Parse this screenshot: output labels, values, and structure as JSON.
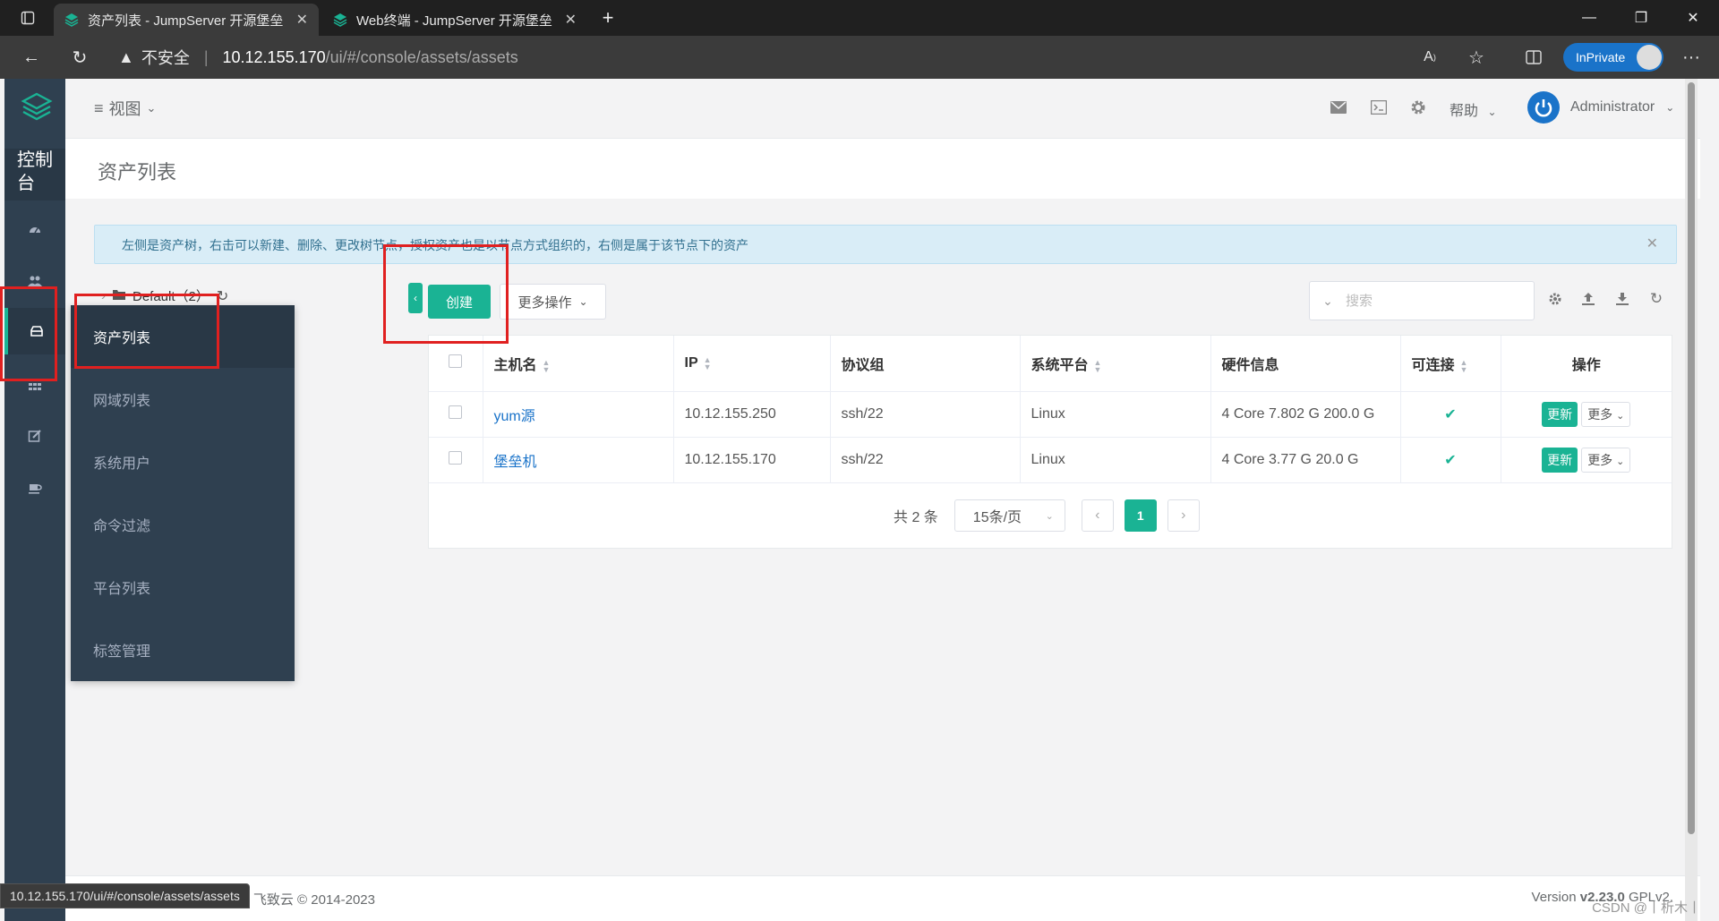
{
  "browser": {
    "tabs": [
      {
        "title": "资产列表 - JumpServer 开源堡垒",
        "active": true
      },
      {
        "title": "Web终端 - JumpServer 开源堡垒",
        "active": false
      }
    ],
    "security_label": "不安全",
    "url_host": "10.12.155.170",
    "url_path": "/ui/#/console/assets/assets",
    "inprivate_label": "InPrivate",
    "status_url": "10.12.155.170/ui/#/console/assets/assets"
  },
  "sidebar": {
    "console_label": "控制台",
    "icons": [
      "dashboard-icon",
      "users-icon",
      "assets-icon",
      "applications-icon",
      "edit-icon",
      "coffee-icon"
    ]
  },
  "header": {
    "view_label": "视图",
    "help_label": "帮助",
    "user_name": "Administrator"
  },
  "page": {
    "title": "资产列表",
    "alert": "左侧是资产树，右击可以新建、删除、更改树节点，授权资产也是以节点方式组织的，右侧是属于该节点下的资产",
    "tree_root": "Default（2）"
  },
  "submenu": {
    "items": [
      "资产列表",
      "网域列表",
      "系统用户",
      "命令过滤",
      "平台列表",
      "标签管理"
    ]
  },
  "toolbar": {
    "create_label": "创建",
    "more_actions_label": "更多操作",
    "search_placeholder": "搜索"
  },
  "table": {
    "columns": [
      "主机名",
      "IP",
      "协议组",
      "系统平台",
      "硬件信息",
      "可连接",
      "操作"
    ],
    "rows": [
      {
        "hostname": "yum源",
        "ip": "10.12.155.250",
        "protocols": "ssh/22",
        "platform": "Linux",
        "hardware": "4 Core 7.802 G 200.0 G",
        "connectable": "✔",
        "update": "更新",
        "more": "更多"
      },
      {
        "hostname": "堡垒机",
        "ip": "10.12.155.170",
        "protocols": "ssh/22",
        "platform": "Linux",
        "hardware": "4 Core 3.77 G 20.0 G",
        "connectable": "✔",
        "update": "更新",
        "more": "更多"
      }
    ]
  },
  "pagination": {
    "total_label": "共 2 条",
    "page_size": "15条/页",
    "current_page": "1"
  },
  "footer": {
    "copyright": "Copyright FIT2CLOUD 飞致云 © 2014-2023",
    "version_prefix": "Version ",
    "version_number": "v2.23.0",
    "version_suffix": " GPLv2.",
    "watermark": "CSDN @丨析木丨"
  },
  "colors": {
    "accent": "#1ab394",
    "sidebar": "#2f4050",
    "link": "#1a73c9",
    "annotation": "#e02020"
  }
}
